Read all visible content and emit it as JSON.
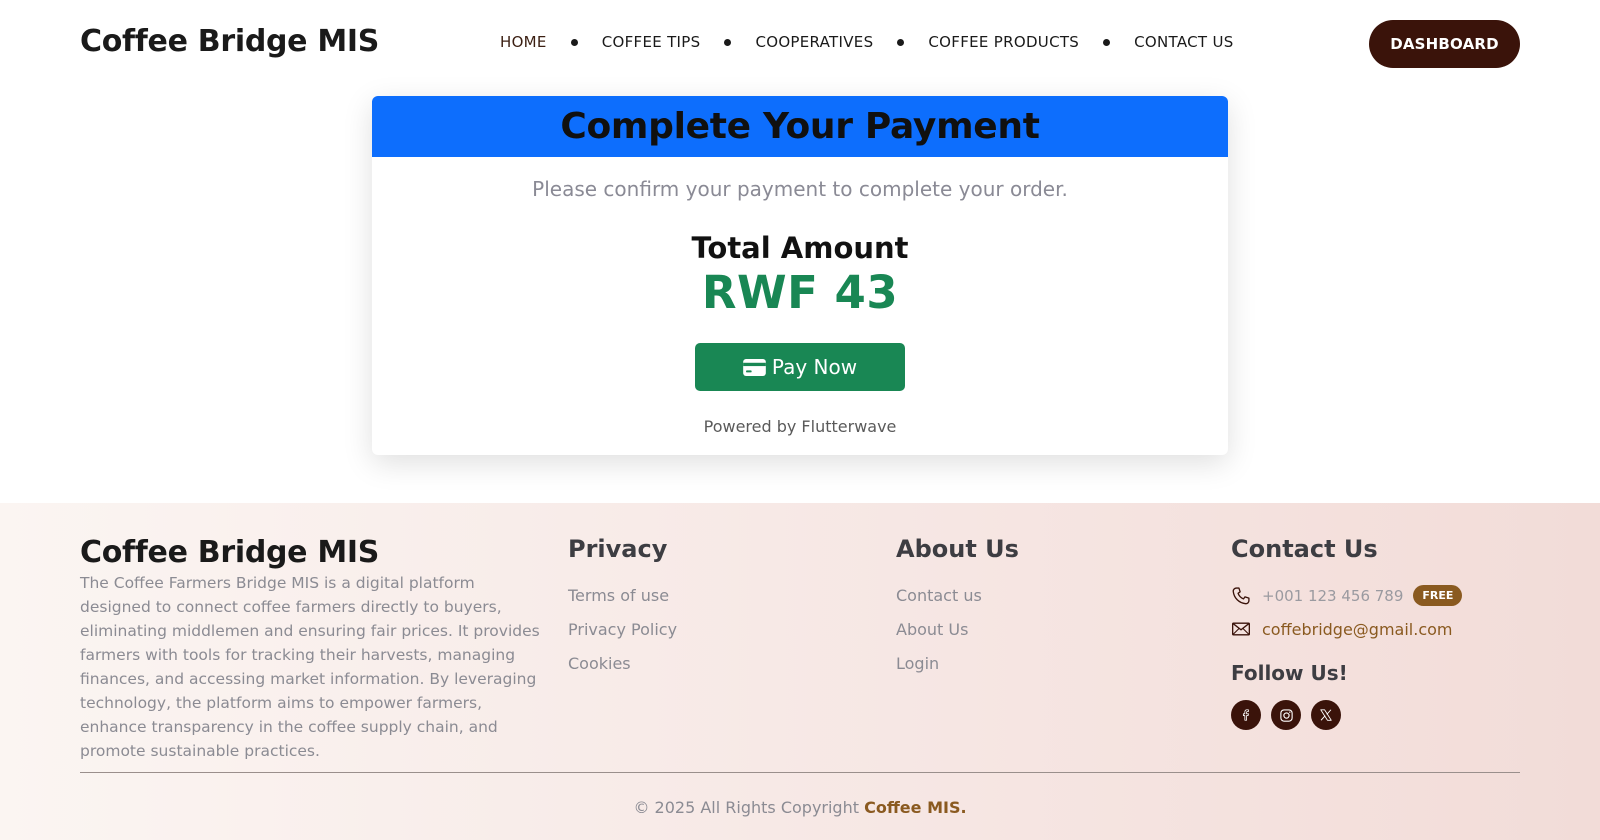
{
  "header": {
    "brand": "Coffee Bridge MIS",
    "nav": [
      {
        "label": "HOME",
        "active": true
      },
      {
        "label": "COFFEE TIPS"
      },
      {
        "label": "COOPERATIVES"
      },
      {
        "label": "COFFEE PRODUCTS"
      },
      {
        "label": "CONTACT US"
      }
    ],
    "dashboard_label": "DASHBOARD"
  },
  "payment": {
    "title": "Complete Your Payment",
    "subtitle": "Please confirm your payment to complete your order.",
    "total_label": "Total Amount",
    "total_amount": "RWF 43",
    "pay_button": "Pay Now",
    "powered_by": "Powered by Flutterwave"
  },
  "footer": {
    "brand": "Coffee Bridge MIS",
    "description": "The Coffee Farmers Bridge MIS is a digital platform designed to connect coffee farmers directly to buyers, eliminating middlemen and ensuring fair prices. It provides farmers with tools for tracking their harvests, managing finances, and accessing market information. By leveraging technology, the platform aims to empower farmers, enhance transparency in the coffee supply chain, and promote sustainable practices.",
    "privacy": {
      "title": "Privacy",
      "links": [
        "Terms of use",
        "Privacy Policy",
        "Cookies"
      ]
    },
    "about": {
      "title": "About Us",
      "links": [
        "Contact us",
        "About Us",
        "Login"
      ]
    },
    "contact": {
      "title": "Contact Us",
      "phone": "+001 123 456 789",
      "badge": "FREE",
      "email": "coffebridge@gmail.com",
      "follow_label": "Follow Us!",
      "socials": [
        "facebook-icon",
        "instagram-icon",
        "x-icon"
      ]
    },
    "copyright_prefix": "© 2025 All Rights Copyright",
    "copyright_brand": "Coffee MIS."
  },
  "colors": {
    "primary_blue": "#0d6efd",
    "success_green": "#198754",
    "brand_brown": "#3a130a",
    "accent_gold": "#8a5a20"
  }
}
